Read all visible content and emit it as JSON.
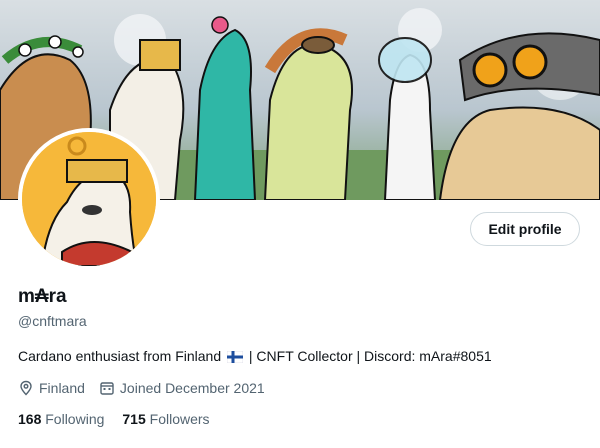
{
  "profile": {
    "display_name": "m₳ra",
    "handle": "@cnftmara",
    "bio_before_flag": "Cardano enthusiast from Finland",
    "bio_flag_icon": "finland-flag-icon",
    "bio_after_flag": "| CNFT Collector | Discord: mAra#8051",
    "location": "Finland",
    "joined": "Joined December 2021",
    "following_count": "168",
    "following_label": "Following",
    "followers_count": "715",
    "followers_label": "Followers"
  },
  "actions": {
    "edit_profile_label": "Edit profile"
  },
  "icons": {
    "location": "location-pin-icon",
    "joined": "calendar-icon"
  },
  "colors": {
    "text_primary": "#0f1419",
    "text_secondary": "#536471",
    "button_border": "#cfd9de",
    "avatar_background": "#f6b83a"
  }
}
